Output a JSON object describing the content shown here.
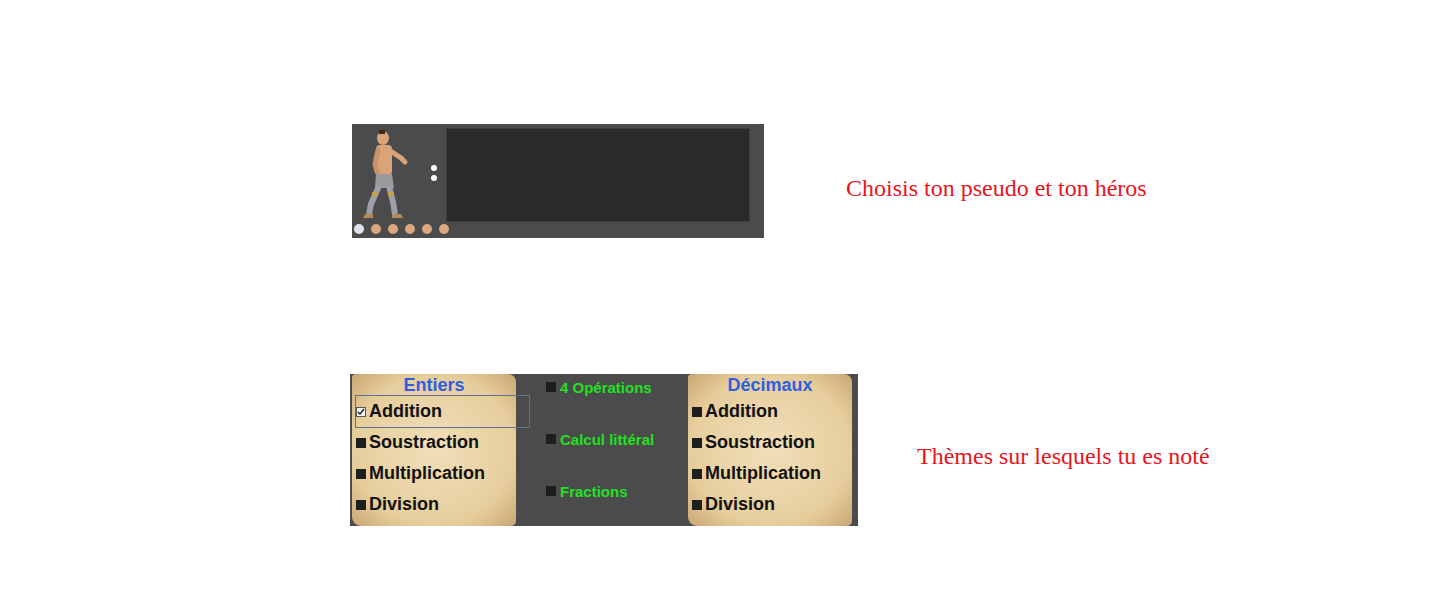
{
  "intro": {
    "pseudo": {
      "value": ""
    },
    "hero_dots": [
      {
        "selected": true
      },
      {
        "selected": false
      },
      {
        "selected": false
      },
      {
        "selected": false
      },
      {
        "selected": false
      },
      {
        "selected": false
      }
    ],
    "label": "Choisis ton pseudo et ton héros"
  },
  "themes": {
    "entiers": {
      "title": "Entiers",
      "items": [
        {
          "label": "Addition",
          "checked": true,
          "focused": true
        },
        {
          "label": "Soustraction",
          "checked": false,
          "focused": false
        },
        {
          "label": "Multiplication",
          "checked": false,
          "focused": false
        },
        {
          "label": "Division",
          "checked": false,
          "focused": false
        }
      ]
    },
    "middle": [
      {
        "label": "4 Opérations",
        "checked": false
      },
      {
        "label": "Calcul littéral",
        "checked": false
      },
      {
        "label": "Fractions",
        "checked": false
      }
    ],
    "decimaux": {
      "title": "Décimaux",
      "items": [
        {
          "label": "Addition",
          "checked": false,
          "focused": false
        },
        {
          "label": "Soustraction",
          "checked": false,
          "focused": false
        },
        {
          "label": "Multiplication",
          "checked": false,
          "focused": false
        },
        {
          "label": "Division",
          "checked": false,
          "focused": false
        }
      ]
    },
    "label": "Thèmes sur lesquels tu es noté"
  }
}
